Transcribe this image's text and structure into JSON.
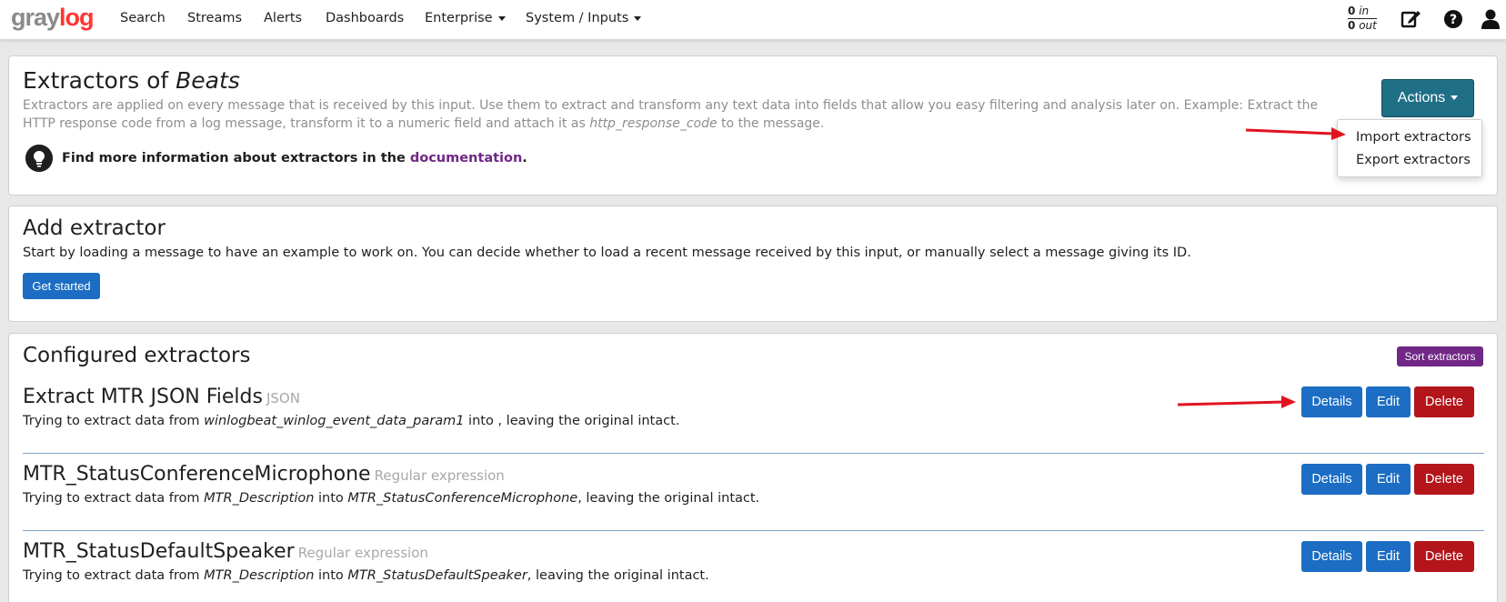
{
  "navbar": {
    "logo_part1": "gray",
    "logo_part2": "log",
    "links": [
      "Search",
      "Streams",
      "Alerts",
      "Dashboards",
      "Enterprise",
      "System / Inputs"
    ],
    "throughput": {
      "in_value": "0",
      "in_label": "in",
      "out_value": "0",
      "out_label": "out"
    },
    "icons": [
      "edit-icon",
      "help-icon",
      "user-icon"
    ]
  },
  "header": {
    "title_prefix": "Extractors of ",
    "title_input": "Beats",
    "description_part1": "Extractors are applied on every message that is received by this input. Use them to extract and transform any text data into fields that allow you easy filtering and analysis later on. Example: Extract the HTTP response code from a log message, transform it to a numeric field and attach it as ",
    "description_field": "http_response_code",
    "description_part2": " to the message.",
    "info_text": "Find more information about extractors in the ",
    "info_link": "documentation",
    "info_end": ".",
    "actions_label": "Actions",
    "dropdown_items": [
      "Import extractors",
      "Export extractors"
    ]
  },
  "add_extractor": {
    "title": "Add extractor",
    "description": "Start by loading a message to have an example to work on. You can decide whether to load a recent message received by this input, or manually select a message giving its ID.",
    "button": "Get started"
  },
  "configured": {
    "title": "Configured extractors",
    "sort_button": "Sort extractors",
    "prefix": "Trying to extract data from ",
    "into": " into ",
    "suffix": ", leaving the original intact.",
    "buttons": {
      "details": "Details",
      "edit": "Edit",
      "delete": "Delete"
    },
    "extractors": [
      {
        "name": "Extract MTR JSON Fields",
        "type": "JSON",
        "source": "winlogbeat_winlog_event_data_param1",
        "target": ""
      },
      {
        "name": "MTR_StatusConferenceMicrophone",
        "type": "Regular expression",
        "source": "MTR_Description",
        "target": "MTR_StatusConferenceMicrophone"
      },
      {
        "name": "MTR_StatusDefaultSpeaker",
        "type": "Regular expression",
        "source": "MTR_Description",
        "target": "MTR_StatusDefaultSpeaker"
      }
    ]
  },
  "colors": {
    "primary": "#1c6dc3",
    "danger": "#b3151b",
    "actions": "#1f6f87",
    "purple": "#702785",
    "annotation_arrow": "#e0141e"
  }
}
